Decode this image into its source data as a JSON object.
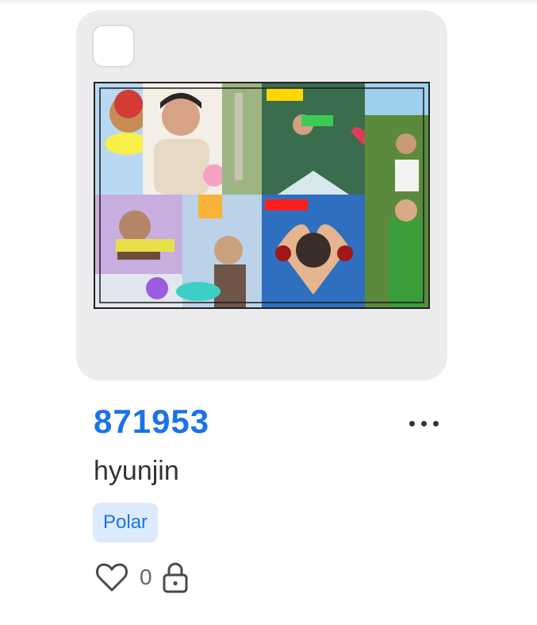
{
  "card": {
    "title": "871953",
    "subtitle": "hyunjin",
    "tag": "Polar",
    "like_count": "0",
    "icons": {
      "select": "checkbox-icon",
      "more": "more-dots-icon",
      "like": "heart-icon",
      "lock": "lock-icon"
    },
    "colors": {
      "title": "#1a73e8",
      "tag_bg": "#dcebfb",
      "card_bg": "#ececee"
    }
  }
}
